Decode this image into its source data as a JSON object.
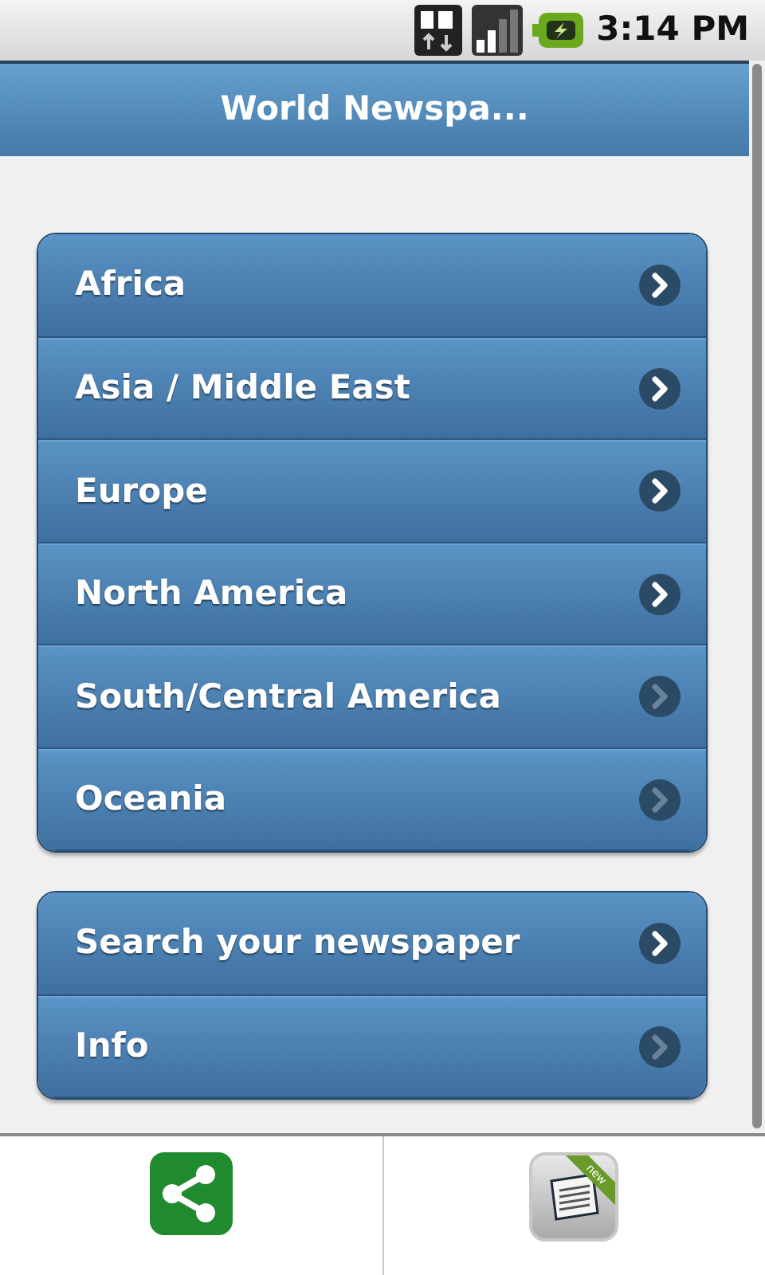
{
  "status_bar": {
    "time": "3:14 PM"
  },
  "header": {
    "title": "World Newspa..."
  },
  "groups": [
    {
      "items": [
        {
          "label": "Africa",
          "active": true
        },
        {
          "label": "Asia / Middle East",
          "active": true
        },
        {
          "label": "Europe",
          "active": true
        },
        {
          "label": "North America",
          "active": true
        },
        {
          "label": "South/Central America",
          "active": false
        },
        {
          "label": "Oceania",
          "active": false
        }
      ]
    },
    {
      "items": [
        {
          "label": "Search your newspaper",
          "active": true
        },
        {
          "label": "Info",
          "active": false
        }
      ]
    }
  ],
  "bottom_bar": {
    "items": [
      {
        "kind": "share"
      },
      {
        "kind": "newspaper",
        "badge": "new"
      }
    ]
  }
}
